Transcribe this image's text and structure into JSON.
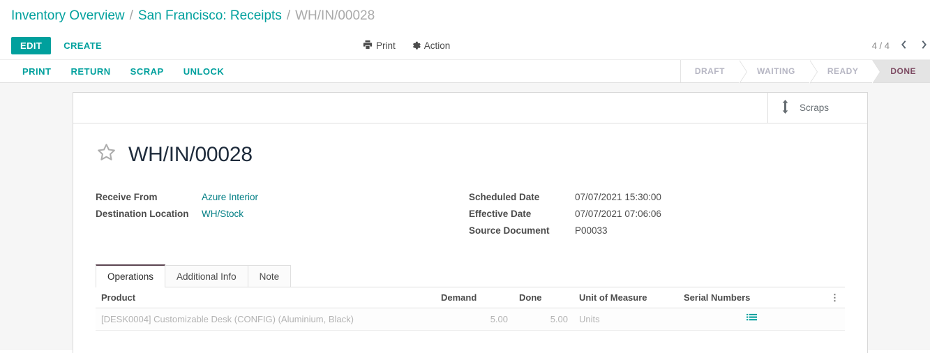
{
  "breadcrumb": {
    "items": [
      {
        "label": "Inventory Overview",
        "type": "link"
      },
      {
        "label": "San Francisco: Receipts",
        "type": "link"
      },
      {
        "label": "WH/IN/00028",
        "type": "current"
      }
    ],
    "separator": "/"
  },
  "control_panel": {
    "edit_label": "EDIT",
    "create_label": "CREATE",
    "print_label": "Print",
    "action_label": "Action",
    "pager_value": "4 / 4",
    "pager_prev": "‹",
    "pager_next": "›"
  },
  "statusbar": {
    "buttons": [
      {
        "label": "PRINT"
      },
      {
        "label": "RETURN"
      },
      {
        "label": "SCRAP"
      },
      {
        "label": "UNLOCK"
      }
    ],
    "stages": [
      {
        "label": "DRAFT",
        "active": false
      },
      {
        "label": "WAITING",
        "active": false
      },
      {
        "label": "READY",
        "active": false
      },
      {
        "label": "DONE",
        "active": true
      }
    ]
  },
  "button_box": {
    "scraps_label": "Scraps",
    "scraps_icon": "arrows-vertical-icon"
  },
  "record": {
    "title": "WH/IN/00028",
    "favorite_icon": "star-outline-icon",
    "fields_left": [
      {
        "label": "Receive From",
        "value": "Azure Interior",
        "link": true
      },
      {
        "label": "Destination Location",
        "value": "WH/Stock",
        "link": true
      }
    ],
    "fields_right": [
      {
        "label": "Scheduled Date",
        "value": "07/07/2021 15:30:00",
        "link": false
      },
      {
        "label": "Effective Date",
        "value": "07/07/2021 07:06:06",
        "link": false
      },
      {
        "label": "Source Document",
        "value": "P00033",
        "link": false
      }
    ]
  },
  "notebook": {
    "tabs": [
      {
        "label": "Operations",
        "active": true
      },
      {
        "label": "Additional Info",
        "active": false
      },
      {
        "label": "Note",
        "active": false
      }
    ]
  },
  "operations_table": {
    "columns": [
      "Product",
      "Demand",
      "Done",
      "Unit of Measure",
      "Serial Numbers"
    ],
    "optional_columns_icon": "vertical-ellipsis-icon",
    "rows": [
      {
        "product": "[DESK0004] Customizable Desk (CONFIG) (Aluminium, Black)",
        "demand": "5.00",
        "done": "5.00",
        "uom": "Units",
        "serial_numbers": "",
        "detail_icon": "list-detail-icon"
      }
    ]
  },
  "colors": {
    "accent_teal": "#00a09d",
    "link_teal": "#017e84",
    "status_active": "#7d4b63",
    "text_dark": "#4c4c4c",
    "muted": "#b3b3b3"
  }
}
